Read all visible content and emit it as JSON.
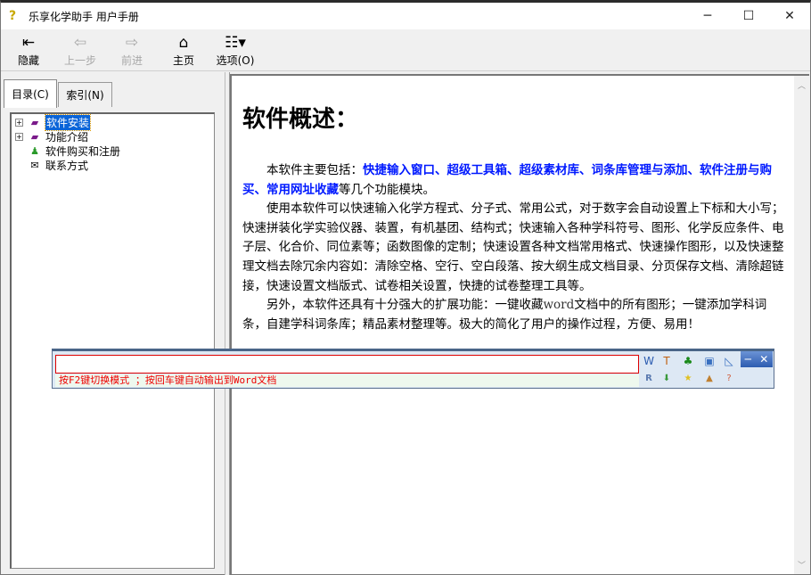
{
  "window": {
    "title": "乐享化学助手 用户手册",
    "minimize": "─",
    "maximize": "☐",
    "close": "✕"
  },
  "toolbar": {
    "hide": "隐藏",
    "back": "上一步",
    "forward": "前进",
    "home": "主页",
    "options": "选项(O)"
  },
  "tabs": {
    "contents": "目录(C)",
    "index": "索引(N)"
  },
  "tree": [
    "软件安装",
    "功能介绍",
    "软件购买和注册",
    "联系方式"
  ],
  "content": {
    "heading": "软件概述：",
    "p1_a": "本软件主要包括：",
    "p1_hl": "快捷输入窗口、超级工具箱、超级素材库、词条库管理与添加、软件注册与购买、常用网址收藏",
    "p1_b": "等几个功能模块。",
    "p2": "使用本软件可以快速输入化学方程式、分子式、常用公式，对于数字会自动设置上下标和大小写；快速拼装化学实验仪器、装置，有机基团、结构式；快速输入各种学科符号、图形、化学反应条件、电子层、化合价、同位素等；函数图像的定制；快速设置各种文档常用格式、快速操作图形，以及快速整理文档去除冗余内容如：清除空格、空行、空白段落、按大纲生成文档目录、分页保存文档、清除超链接，快速设置文档版式、试卷相关设置，快捷的试卷整理工具等。",
    "p3_a": "另外，本软件还具有十分强大的扩展功能：一键收藏",
    "p3_word": "word",
    "p3_b": "文档中的所有图形；一键添加学科词条，自建学科词条库；精品素材整理等。极大的简化了用户的操作过程，方便、易用！"
  },
  "floating": {
    "input_value": "",
    "hint": "按F2键切换模式 ；按回车键自动输出到Word文档",
    "min": "─",
    "close": "✕"
  }
}
